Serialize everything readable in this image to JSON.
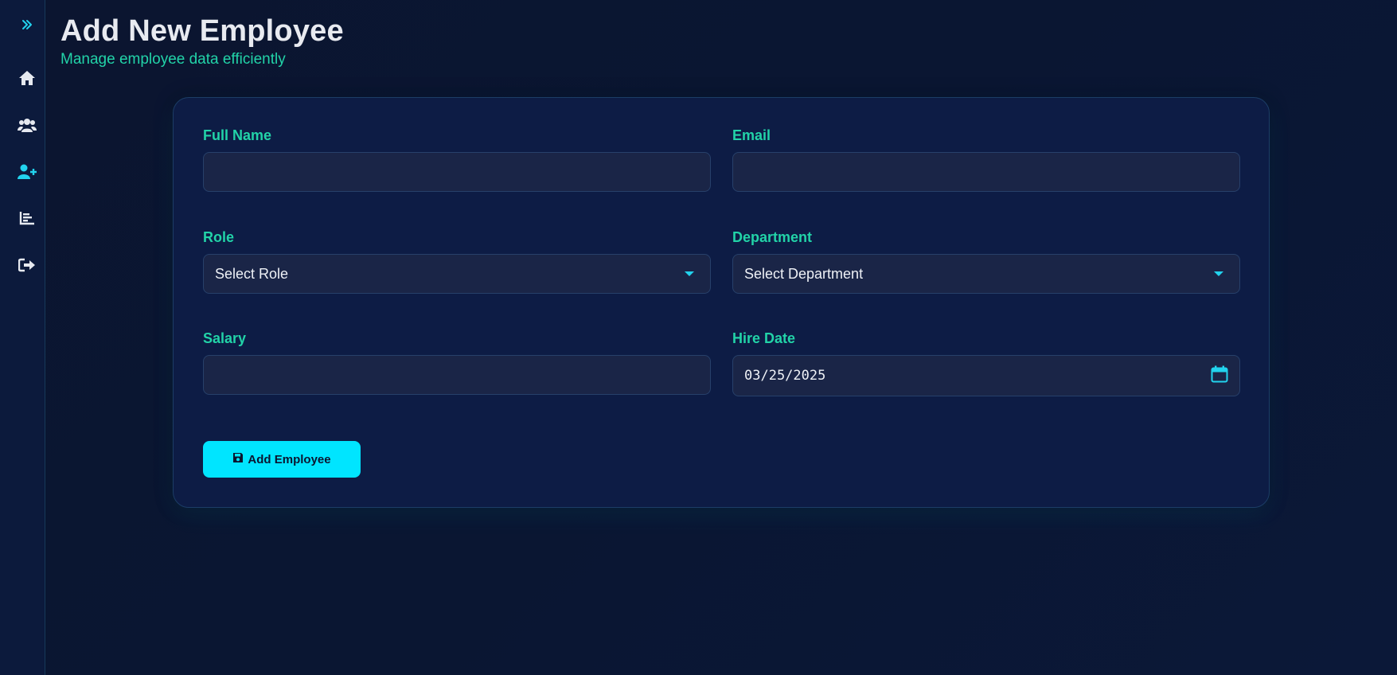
{
  "page": {
    "title": "Add New Employee",
    "subtitle": "Manage employee data efficiently"
  },
  "sidebar": {
    "items": [
      {
        "icon": "chevrons-right-icon",
        "label": "Expand"
      },
      {
        "icon": "home-icon",
        "label": "Home"
      },
      {
        "icon": "users-icon",
        "label": "Employees"
      },
      {
        "icon": "user-plus-icon",
        "label": "Add Employee",
        "active": true
      },
      {
        "icon": "bar-chart-icon",
        "label": "Reports"
      },
      {
        "icon": "logout-icon",
        "label": "Logout"
      }
    ]
  },
  "form": {
    "full_name": {
      "label": "Full Name",
      "value": ""
    },
    "email": {
      "label": "Email",
      "value": ""
    },
    "role": {
      "label": "Role",
      "value": "Select Role"
    },
    "department": {
      "label": "Department",
      "value": "Select Department"
    },
    "salary": {
      "label": "Salary",
      "value": ""
    },
    "hire_date": {
      "label": "Hire Date",
      "value": "03/25/2025"
    },
    "submit_label": "Add Employee"
  },
  "colors": {
    "accent": "#00e5ff",
    "label": "#22d3a8",
    "background": "#0b1530",
    "card": "#0d1c45",
    "input": "#1a2547"
  }
}
